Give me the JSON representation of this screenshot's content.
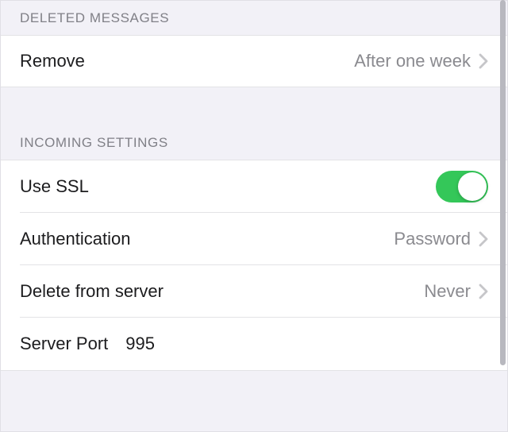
{
  "sections": {
    "deleted_messages": {
      "header": "DELETED MESSAGES",
      "remove": {
        "label": "Remove",
        "value": "After one week"
      }
    },
    "incoming_settings": {
      "header": "INCOMING SETTINGS",
      "use_ssl": {
        "label": "Use SSL",
        "enabled": true
      },
      "authentication": {
        "label": "Authentication",
        "value": "Password"
      },
      "delete_from_server": {
        "label": "Delete from server",
        "value": "Never"
      },
      "server_port": {
        "label": "Server Port",
        "value": "995"
      }
    }
  },
  "colors": {
    "toggle_on": "#34c759"
  }
}
